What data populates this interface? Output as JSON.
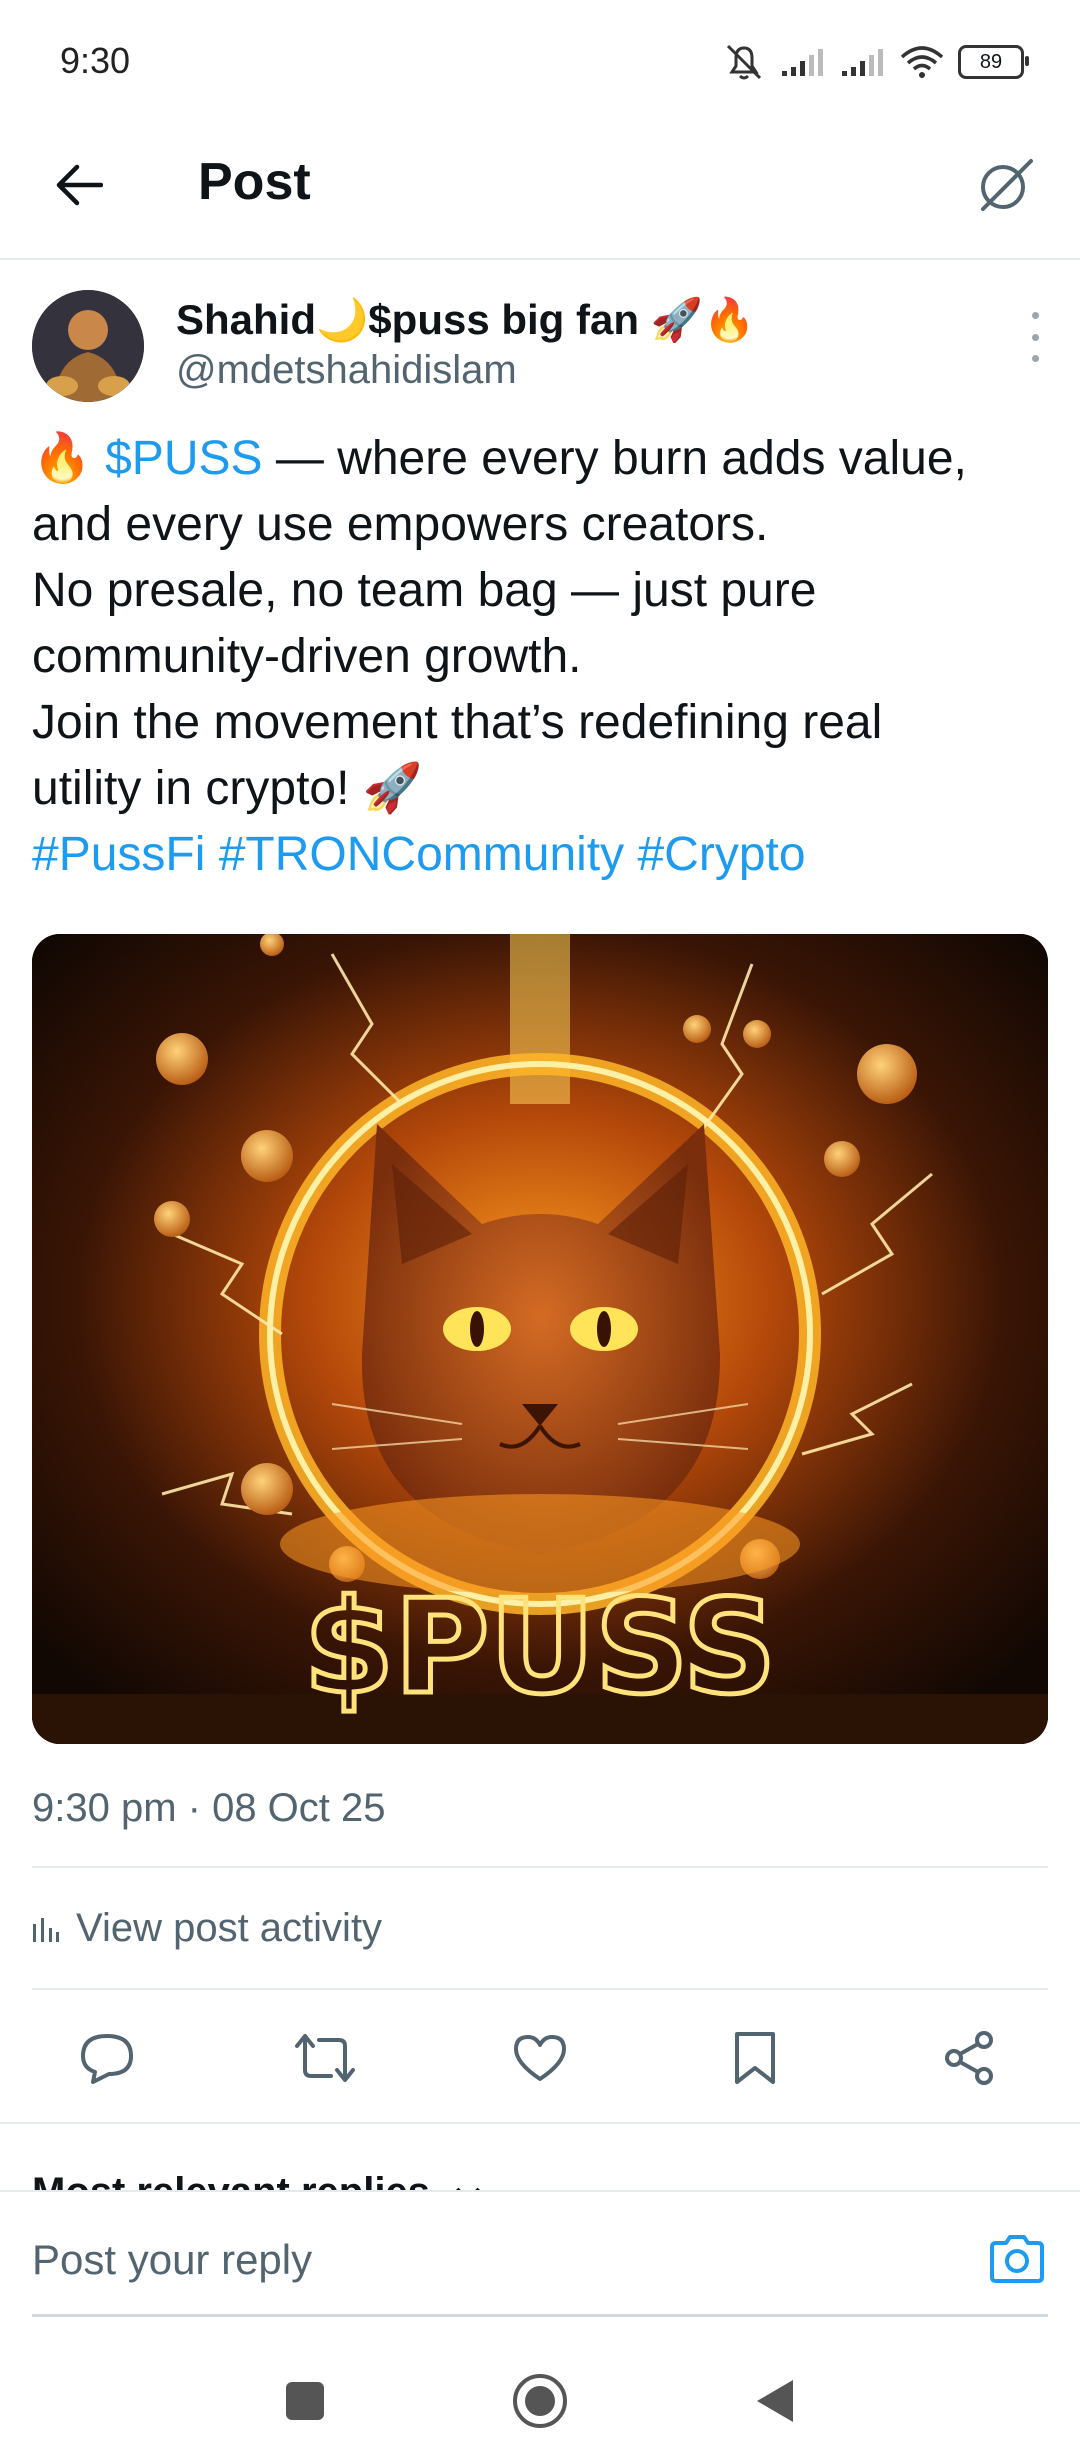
{
  "status_bar": {
    "time": "9:30",
    "battery": "89"
  },
  "header": {
    "title": "Post"
  },
  "author": {
    "name": "Shahid🌙$puss big fan 🚀🔥",
    "handle": "@mdetshahidislam"
  },
  "post": {
    "fire_emoji": "🔥",
    "cashtag": "$PUSS",
    "line1_rest": " — where every burn adds value,",
    "line2": "and every use empowers creators.",
    "line3": "No presale, no team bag — just pure",
    "line4": "community-driven growth.",
    "line5": "Join the movement that’s redefining real",
    "line6": "utility in crypto! 🚀",
    "hashtags": [
      "#PussFi",
      "#TRONCommunity",
      "#Crypto"
    ],
    "image_text": "$PUSS",
    "timestamp": "9:30 pm · 08 Oct 25"
  },
  "activity": {
    "label": "View post activity"
  },
  "replies": {
    "label": "Most relevant replies"
  },
  "reply_bar": {
    "placeholder": "Post your reply"
  },
  "colors": {
    "accent": "#1d9bf0",
    "text": "#0f1419",
    "secondary": "#536471"
  }
}
